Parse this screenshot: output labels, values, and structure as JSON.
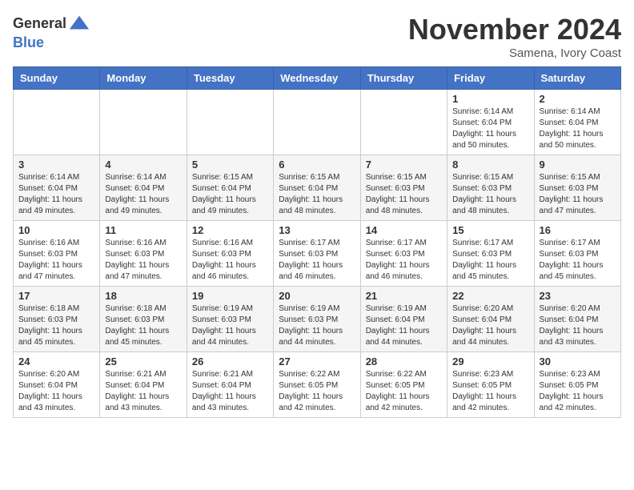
{
  "header": {
    "logo_line1": "General",
    "logo_line2": "Blue",
    "month": "November 2024",
    "location": "Samena, Ivory Coast"
  },
  "days_of_week": [
    "Sunday",
    "Monday",
    "Tuesday",
    "Wednesday",
    "Thursday",
    "Friday",
    "Saturday"
  ],
  "weeks": [
    [
      {
        "day": "",
        "info": ""
      },
      {
        "day": "",
        "info": ""
      },
      {
        "day": "",
        "info": ""
      },
      {
        "day": "",
        "info": ""
      },
      {
        "day": "",
        "info": ""
      },
      {
        "day": "1",
        "info": "Sunrise: 6:14 AM\nSunset: 6:04 PM\nDaylight: 11 hours\nand 50 minutes."
      },
      {
        "day": "2",
        "info": "Sunrise: 6:14 AM\nSunset: 6:04 PM\nDaylight: 11 hours\nand 50 minutes."
      }
    ],
    [
      {
        "day": "3",
        "info": "Sunrise: 6:14 AM\nSunset: 6:04 PM\nDaylight: 11 hours\nand 49 minutes."
      },
      {
        "day": "4",
        "info": "Sunrise: 6:14 AM\nSunset: 6:04 PM\nDaylight: 11 hours\nand 49 minutes."
      },
      {
        "day": "5",
        "info": "Sunrise: 6:15 AM\nSunset: 6:04 PM\nDaylight: 11 hours\nand 49 minutes."
      },
      {
        "day": "6",
        "info": "Sunrise: 6:15 AM\nSunset: 6:04 PM\nDaylight: 11 hours\nand 48 minutes."
      },
      {
        "day": "7",
        "info": "Sunrise: 6:15 AM\nSunset: 6:03 PM\nDaylight: 11 hours\nand 48 minutes."
      },
      {
        "day": "8",
        "info": "Sunrise: 6:15 AM\nSunset: 6:03 PM\nDaylight: 11 hours\nand 48 minutes."
      },
      {
        "day": "9",
        "info": "Sunrise: 6:15 AM\nSunset: 6:03 PM\nDaylight: 11 hours\nand 47 minutes."
      }
    ],
    [
      {
        "day": "10",
        "info": "Sunrise: 6:16 AM\nSunset: 6:03 PM\nDaylight: 11 hours\nand 47 minutes."
      },
      {
        "day": "11",
        "info": "Sunrise: 6:16 AM\nSunset: 6:03 PM\nDaylight: 11 hours\nand 47 minutes."
      },
      {
        "day": "12",
        "info": "Sunrise: 6:16 AM\nSunset: 6:03 PM\nDaylight: 11 hours\nand 46 minutes."
      },
      {
        "day": "13",
        "info": "Sunrise: 6:17 AM\nSunset: 6:03 PM\nDaylight: 11 hours\nand 46 minutes."
      },
      {
        "day": "14",
        "info": "Sunrise: 6:17 AM\nSunset: 6:03 PM\nDaylight: 11 hours\nand 46 minutes."
      },
      {
        "day": "15",
        "info": "Sunrise: 6:17 AM\nSunset: 6:03 PM\nDaylight: 11 hours\nand 45 minutes."
      },
      {
        "day": "16",
        "info": "Sunrise: 6:17 AM\nSunset: 6:03 PM\nDaylight: 11 hours\nand 45 minutes."
      }
    ],
    [
      {
        "day": "17",
        "info": "Sunrise: 6:18 AM\nSunset: 6:03 PM\nDaylight: 11 hours\nand 45 minutes."
      },
      {
        "day": "18",
        "info": "Sunrise: 6:18 AM\nSunset: 6:03 PM\nDaylight: 11 hours\nand 45 minutes."
      },
      {
        "day": "19",
        "info": "Sunrise: 6:19 AM\nSunset: 6:03 PM\nDaylight: 11 hours\nand 44 minutes."
      },
      {
        "day": "20",
        "info": "Sunrise: 6:19 AM\nSunset: 6:03 PM\nDaylight: 11 hours\nand 44 minutes."
      },
      {
        "day": "21",
        "info": "Sunrise: 6:19 AM\nSunset: 6:04 PM\nDaylight: 11 hours\nand 44 minutes."
      },
      {
        "day": "22",
        "info": "Sunrise: 6:20 AM\nSunset: 6:04 PM\nDaylight: 11 hours\nand 44 minutes."
      },
      {
        "day": "23",
        "info": "Sunrise: 6:20 AM\nSunset: 6:04 PM\nDaylight: 11 hours\nand 43 minutes."
      }
    ],
    [
      {
        "day": "24",
        "info": "Sunrise: 6:20 AM\nSunset: 6:04 PM\nDaylight: 11 hours\nand 43 minutes."
      },
      {
        "day": "25",
        "info": "Sunrise: 6:21 AM\nSunset: 6:04 PM\nDaylight: 11 hours\nand 43 minutes."
      },
      {
        "day": "26",
        "info": "Sunrise: 6:21 AM\nSunset: 6:04 PM\nDaylight: 11 hours\nand 43 minutes."
      },
      {
        "day": "27",
        "info": "Sunrise: 6:22 AM\nSunset: 6:05 PM\nDaylight: 11 hours\nand 42 minutes."
      },
      {
        "day": "28",
        "info": "Sunrise: 6:22 AM\nSunset: 6:05 PM\nDaylight: 11 hours\nand 42 minutes."
      },
      {
        "day": "29",
        "info": "Sunrise: 6:23 AM\nSunset: 6:05 PM\nDaylight: 11 hours\nand 42 minutes."
      },
      {
        "day": "30",
        "info": "Sunrise: 6:23 AM\nSunset: 6:05 PM\nDaylight: 11 hours\nand 42 minutes."
      }
    ]
  ]
}
